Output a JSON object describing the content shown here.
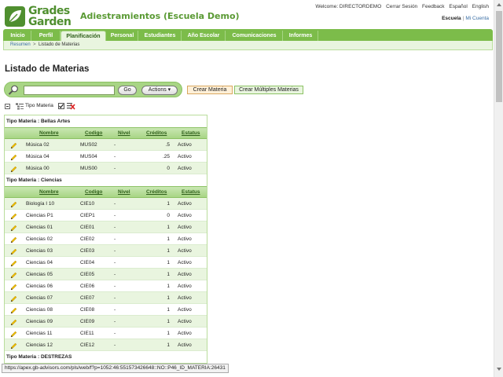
{
  "app": {
    "logo_line1": "Grades",
    "logo_line2": "Garden",
    "title": "Adiestramientos (Escuela Demo)"
  },
  "top_links": {
    "welcome": "Welcome: DIRECTORDEMO",
    "cerrar": "Cerrar Sesión",
    "feedback": "Feedback",
    "espanol": "Español",
    "english": "English",
    "escuela": "Escuela",
    "separator": "|",
    "mi_cuenta": "Mi Cuenta"
  },
  "tabs": [
    "Inicio",
    "Perfil",
    "Planificación",
    "Personal",
    "Estudiantes",
    "Año Escolar",
    "Comunicaciones",
    "Informes"
  ],
  "active_tab": "Planificación",
  "breadcrumb": {
    "resumen": "Resumen",
    "chevron": ">",
    "current": "Listado de Materias"
  },
  "page_title": "Listado de Materias",
  "search": {
    "value": "",
    "go_label": "Go",
    "actions_label": "Actions ▾"
  },
  "buttons": {
    "crear_materia": "Crear Materia",
    "crear_multiples": "Crear Múltiples Materias"
  },
  "group_control": {
    "label": "Tipo Materia",
    "checked": true
  },
  "columns": {
    "nombre": "Nombre",
    "codigo": "Codigo",
    "nivel": "Nivel",
    "creditos": "Créditos",
    "estatus": "Estatus"
  },
  "groups": [
    {
      "title": "Tipo Materia : Bellas Artes",
      "rows": [
        {
          "nombre": "Música 02",
          "codigo": "MUS02",
          "nivel": "-",
          "creditos": ".5",
          "estatus": "Activo"
        },
        {
          "nombre": "Música 04",
          "codigo": "MUS04",
          "nivel": "-",
          "creditos": ".25",
          "estatus": "Activo"
        },
        {
          "nombre": "Música 00",
          "codigo": "MUS00",
          "nivel": "-",
          "creditos": "0",
          "estatus": "Activo"
        }
      ]
    },
    {
      "title": "Tipo Materia : Ciencias",
      "rows": [
        {
          "nombre": "Biología I 10",
          "codigo": "CIE10",
          "nivel": "-",
          "creditos": "1",
          "estatus": "Activo"
        },
        {
          "nombre": "Ciencias P1",
          "codigo": "CIEP1",
          "nivel": "-",
          "creditos": "0",
          "estatus": "Activo"
        },
        {
          "nombre": "Ciencias 01",
          "codigo": "CIE01",
          "nivel": "-",
          "creditos": "1",
          "estatus": "Activo"
        },
        {
          "nombre": "Ciencias 02",
          "codigo": "CIE02",
          "nivel": "-",
          "creditos": "1",
          "estatus": "Activo"
        },
        {
          "nombre": "Ciencias 03",
          "codigo": "CIE03",
          "nivel": "-",
          "creditos": "1",
          "estatus": "Activo"
        },
        {
          "nombre": "Ciencias 04",
          "codigo": "CIE04",
          "nivel": "-",
          "creditos": "1",
          "estatus": "Activo"
        },
        {
          "nombre": "Ciencias 05",
          "codigo": "CIE05",
          "nivel": "-",
          "creditos": "1",
          "estatus": "Activo"
        },
        {
          "nombre": "Ciencias 06",
          "codigo": "CIE06",
          "nivel": "-",
          "creditos": "1",
          "estatus": "Activo"
        },
        {
          "nombre": "Ciencias 07",
          "codigo": "CIE07",
          "nivel": "-",
          "creditos": "1",
          "estatus": "Activo"
        },
        {
          "nombre": "Ciencias 08",
          "codigo": "CIE08",
          "nivel": "-",
          "creditos": "1",
          "estatus": "Activo"
        },
        {
          "nombre": "Ciencias 09",
          "codigo": "CIE09",
          "nivel": "-",
          "creditos": "1",
          "estatus": "Activo"
        },
        {
          "nombre": "Ciencias 11",
          "codigo": "CIE11",
          "nivel": "-",
          "creditos": "1",
          "estatus": "Activo"
        },
        {
          "nombre": "Ciencias 12",
          "codigo": "CIE12",
          "nivel": "-",
          "creditos": "1",
          "estatus": "Activo"
        }
      ]
    },
    {
      "title": "Tipo Materia : DESTREZAS",
      "rows": []
    }
  ],
  "status_url": "https://apex.gb-advisors.com/pls/web/f?p=1052:46:551573426648::NO::P46_ID_MATERIA:26431",
  "colors": {
    "brand_green": "#7cbc4a",
    "header_green": "#a8d585",
    "row_alt": "#e9f5df",
    "title_green": "#5a9a34"
  }
}
